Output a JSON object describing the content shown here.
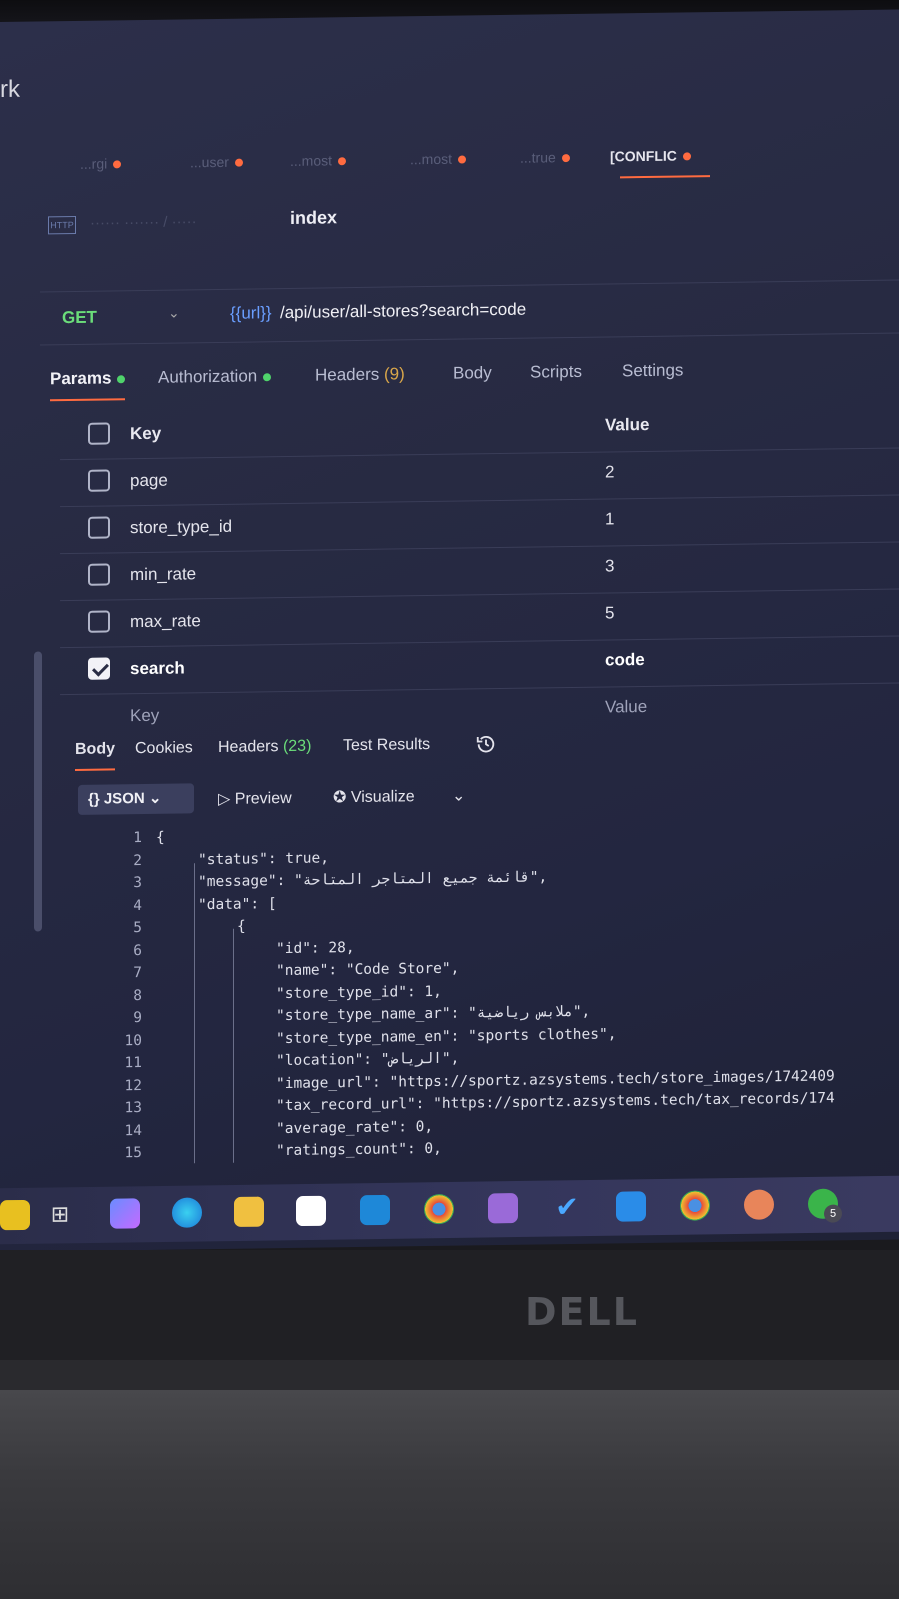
{
  "window": {
    "partial_title": "rk"
  },
  "tabs": [
    {
      "label": "...rgi",
      "active": false
    },
    {
      "label": "...user",
      "active": false
    },
    {
      "label": "...most",
      "active": false
    },
    {
      "label": "...most",
      "active": false
    },
    {
      "label": "...true",
      "active": false
    },
    {
      "label": "[CONFLIC",
      "active": true
    }
  ],
  "request": {
    "name": "index",
    "method": "GET",
    "url_variable": "{{url}}",
    "url_path": " /api/user/all-stores?search=code"
  },
  "request_tabs": {
    "params": "Params",
    "authorization": "Authorization",
    "headers": "Headers",
    "headers_count": "(9)",
    "body": "Body",
    "scripts": "Scripts",
    "settings": "Settings"
  },
  "params": {
    "header": {
      "key": "Key",
      "value": "Value"
    },
    "rows": [
      {
        "key": "page",
        "value": "2",
        "checked": false
      },
      {
        "key": "store_type_id",
        "value": "1",
        "checked": false
      },
      {
        "key": "min_rate",
        "value": "3",
        "checked": false
      },
      {
        "key": "max_rate",
        "value": "5",
        "checked": false
      },
      {
        "key": "search",
        "value": "code",
        "checked": true
      }
    ],
    "placeholder": {
      "key": "Key",
      "value": "Value"
    }
  },
  "response_tabs": {
    "body": "Body",
    "cookies": "Cookies",
    "headers": "Headers",
    "headers_count": "(23)",
    "test_results": "Test Results"
  },
  "response_toolbar": {
    "format": "{} JSON",
    "preview": "Preview",
    "visualize": "Visualize"
  },
  "code_lines": [
    "{",
    "\"status\": true,",
    "\"message\": \"قائمة جميع المتاجر المتاحة\",",
    "\"data\": [",
    "{",
    "\"id\": 28,",
    "\"name\": \"Code Store\",",
    "\"store_type_id\": 1,",
    "\"store_type_name_ar\": \"ملابس رياضية\",",
    "\"store_type_name_en\": \"sports clothes\",",
    "\"location\": \"الرياض\",",
    "\"image_url\": \"https://sportz.azsystems.tech/store_images/1742409",
    "\"tax_record_url\": \"https://sportz.azsystems.tech/tax_records/174",
    "\"average_rate\": 0,",
    "\"ratings_count\": 0,"
  ],
  "line_numbers": [
    "1",
    "2",
    "3",
    "4",
    "5",
    "6",
    "7",
    "8",
    "9",
    "10",
    "11",
    "12",
    "13",
    "14",
    "15"
  ],
  "taskbar_badge": "5",
  "laptop_brand": "DELL",
  "colors": {
    "accent": "#ff6b40",
    "method_get": "#6bdd7a",
    "url_variable": "#6a9eff",
    "active_dot": "#4fd36b"
  }
}
